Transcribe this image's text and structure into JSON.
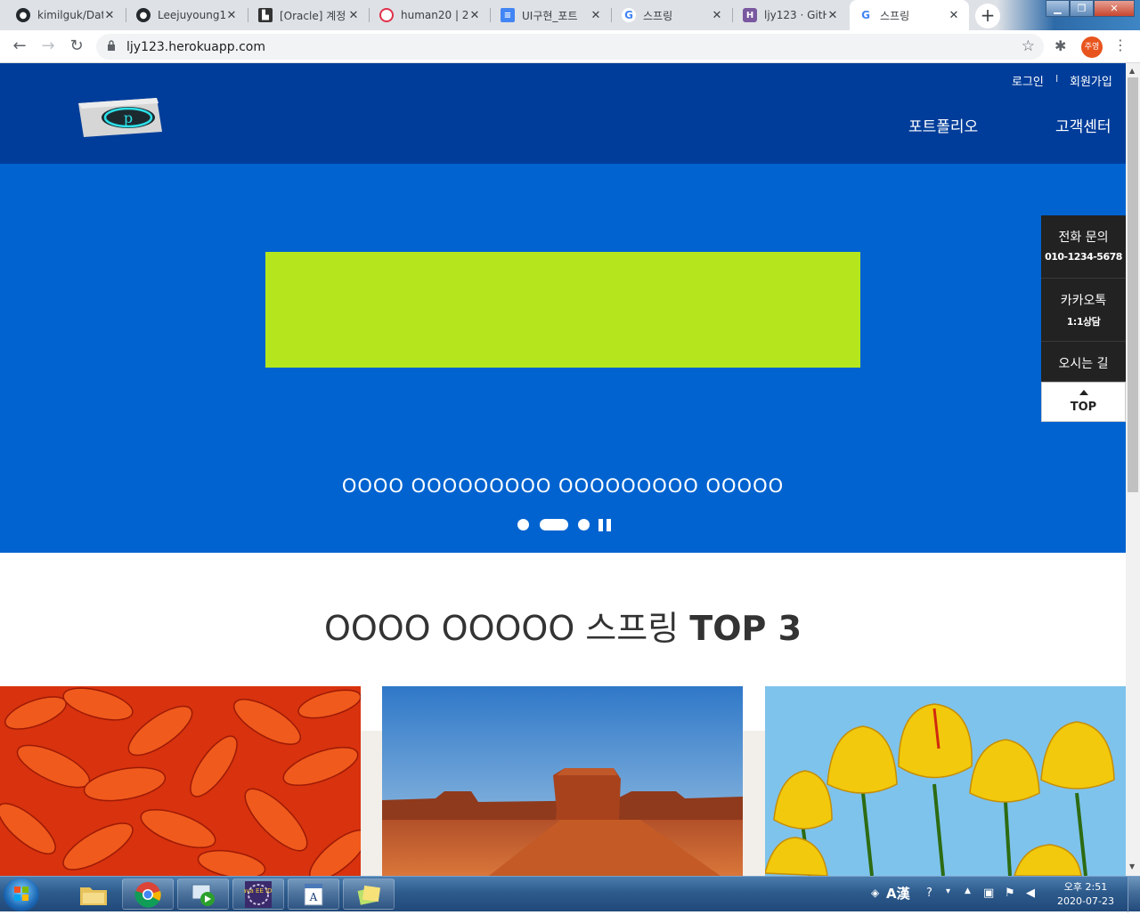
{
  "browser": {
    "tabs": [
      {
        "title": "kimilguk/Dat",
        "favicon": "github-icon"
      },
      {
        "title": "Leejuyoung1",
        "favicon": "github-icon"
      },
      {
        "title": "[Oracle] 계정",
        "favicon": "factory-icon"
      },
      {
        "title": "human20 | 2",
        "favicon": "oracle-icon"
      },
      {
        "title": "UI구현_포트",
        "favicon": "docs-icon"
      },
      {
        "title": "스프링",
        "favicon": "google-icon"
      },
      {
        "title": "ljy123 · GitH",
        "favicon": "heroku-icon"
      },
      {
        "title": "스프링",
        "favicon": "google-icon",
        "active": true
      }
    ],
    "close_glyph": "✕",
    "new_tab_glyph": "+",
    "url": "ljy123.herokuapp.com",
    "profile_label": "주영"
  },
  "site": {
    "utility_links": {
      "login": "로그인",
      "separator": "I",
      "signup": "회원가입"
    },
    "nav": {
      "portfolio": "포트폴리오",
      "support": "고객센터"
    },
    "hero": {
      "banner_color": "#b5e61d",
      "background_color": "#0063d0",
      "caption": "OOOO OOOOOOOOO OOOOOOOOO OOOOO"
    },
    "quick_menu": {
      "phone_label": "전화 문의",
      "phone_number": "010-1234-5678",
      "kakao_label": "카카오톡",
      "kakao_sub": "1:1상담",
      "directions_label": "오시는 길",
      "top_label": "TOP"
    },
    "section": {
      "title_light": "OOOO OOOOO 스프링",
      "title_bold": "TOP 3"
    },
    "photos": [
      {
        "name": "chrysanthemum"
      },
      {
        "name": "desert"
      },
      {
        "name": "tulips"
      }
    ]
  },
  "taskbar": {
    "apps": [
      "windows-explorer-icon",
      "chrome-icon",
      "media-center-icon",
      "java-ee-ide-icon",
      "wordpad-icon",
      "sticky-notes-icon"
    ],
    "java_label": "Java EE IDE",
    "ime_label": "A漢",
    "clock_time": "오후 2:51",
    "clock_date": "2020-07-23"
  },
  "colors": {
    "header": "#003d9a",
    "hero": "#0063d0",
    "banner": "#b5e61d",
    "quick_menu": "#222222"
  }
}
